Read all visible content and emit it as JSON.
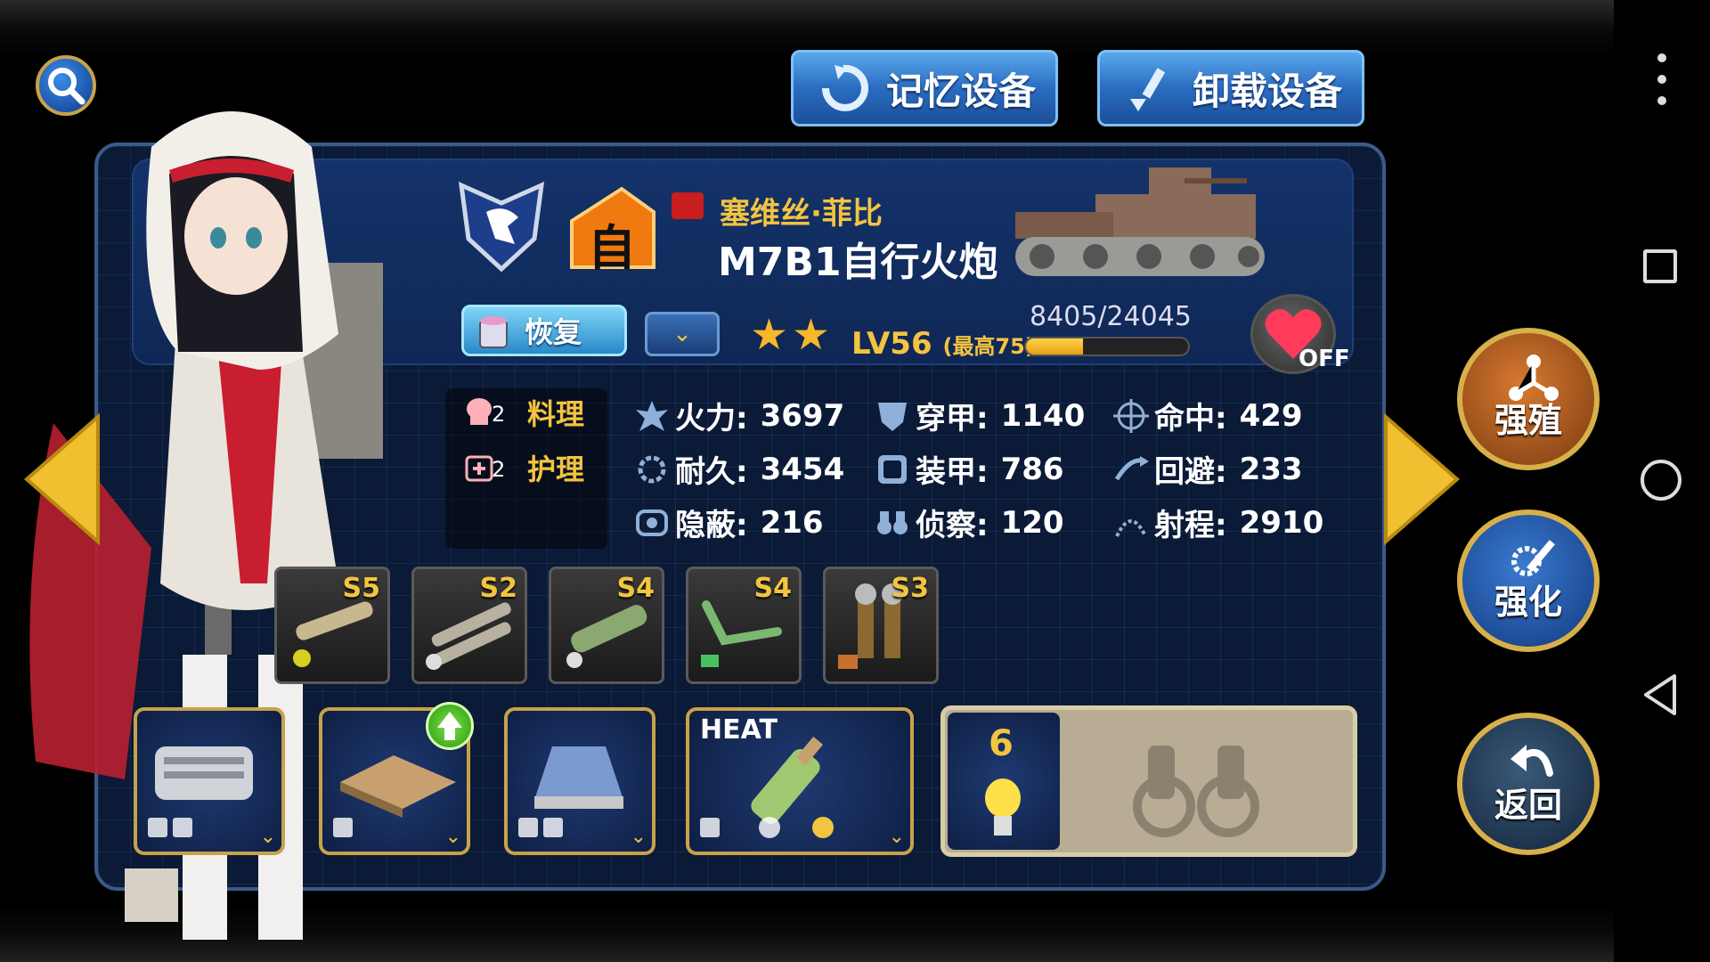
{
  "top_buttons": {
    "memory_label": "记忆设备",
    "unload_label": "卸载设备"
  },
  "unit": {
    "name": "塞维丝·菲比",
    "class": "M7B1自行火炮",
    "type_badge": "自",
    "stars": "★★",
    "level": "LV56",
    "level_max": "(最高75)",
    "exp_text": "8405/24045",
    "exp_fraction": 0.35,
    "restore_label": "恢复",
    "heart_label": "OFF"
  },
  "skills": [
    {
      "count": "2",
      "label": "料理",
      "icon": "chef-icon"
    },
    {
      "count": "2",
      "label": "护理",
      "icon": "medkit-icon"
    }
  ],
  "stats": {
    "firepower": {
      "label": "火力:",
      "value": "3697"
    },
    "penetration": {
      "label": "穿甲:",
      "value": "1140"
    },
    "accuracy": {
      "label": "命中:",
      "value": "429"
    },
    "durability": {
      "label": "耐久:",
      "value": "3454"
    },
    "armor": {
      "label": "装甲:",
      "value": "786"
    },
    "evasion": {
      "label": "回避:",
      "value": "233"
    },
    "stealth": {
      "label": "隐蔽:",
      "value": "216"
    },
    "recon": {
      "label": "侦察:",
      "value": "120"
    },
    "range": {
      "label": "射程:",
      "value": "2910"
    }
  },
  "weapon_slots": [
    {
      "grade": "S5",
      "icon": "cannon-icon"
    },
    {
      "grade": "S2",
      "icon": "shells-icon"
    },
    {
      "grade": "S4",
      "icon": "barrel-icon"
    },
    {
      "grade": "S4",
      "icon": "pipe-icon"
    },
    {
      "grade": "S3",
      "icon": "binocular-stand-icon"
    }
  ],
  "equipment": [
    {
      "icon": "engine-icon",
      "tag": ""
    },
    {
      "icon": "armor-plate-icon",
      "tag": ""
    },
    {
      "icon": "turret-icon",
      "tag": ""
    },
    {
      "icon": "heat-shell-icon",
      "tag": "HEAT"
    }
  ],
  "scout": {
    "count": "6",
    "icon": "binoculars-icon"
  },
  "side_buttons": {
    "breed_label": "强殖",
    "enhance_label": "强化",
    "back_label": "返回"
  },
  "colors": {
    "gold": "#f3c440",
    "panel": "#0b1a36",
    "button_blue": "#2a6cc0"
  }
}
